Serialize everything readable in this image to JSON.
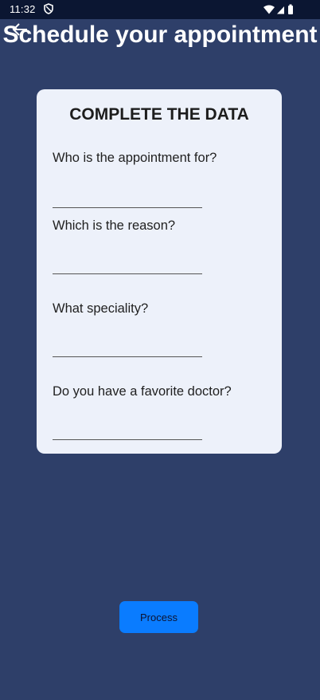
{
  "status_bar": {
    "time": "11:32",
    "icons": [
      "shield-icon",
      "wifi-icon",
      "signal-icon",
      "battery-icon"
    ]
  },
  "header": {
    "back_icon": "arrow-left-icon",
    "title": "Schedule your appointment"
  },
  "form": {
    "title": "COMPLETE THE DATA",
    "fields": [
      {
        "label": "Who is the appointment for?",
        "value": ""
      },
      {
        "label": "Which is the reason?",
        "value": ""
      },
      {
        "label": "What speciality?",
        "value": ""
      },
      {
        "label": "Do you have a favorite doctor?",
        "value": ""
      }
    ]
  },
  "actions": {
    "process_label": "Process"
  },
  "colors": {
    "background": "#2e3f69",
    "status_bar": "#0b1632",
    "card": "#edf1fa",
    "button": "#0a7cff"
  }
}
